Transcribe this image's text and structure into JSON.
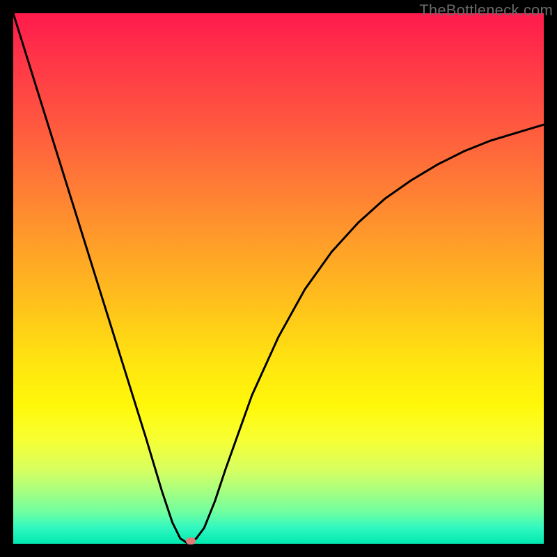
{
  "watermark": "TheBottleneck.com",
  "chart_data": {
    "type": "line",
    "title": "",
    "xlabel": "",
    "ylabel": "",
    "xlim": [
      0,
      100
    ],
    "ylim": [
      0,
      100
    ],
    "series": [
      {
        "name": "bottleneck-curve",
        "x": [
          0,
          5,
          10,
          15,
          20,
          25,
          28,
          30,
          31.5,
          33,
          34.5,
          36,
          38,
          40,
          45,
          50,
          55,
          60,
          65,
          70,
          75,
          80,
          85,
          90,
          95,
          100
        ],
        "y": [
          100,
          84,
          68,
          52,
          36,
          20,
          10,
          4,
          1,
          0,
          1,
          3,
          8,
          14,
          28,
          39,
          48,
          55,
          60.5,
          65,
          68.5,
          71.5,
          74,
          76,
          77.5,
          79
        ]
      }
    ],
    "marker": {
      "x": 33.5,
      "y": 0.5
    },
    "background_gradient": {
      "top": "#ff1a4d",
      "mid_upper": "#ffa028",
      "mid": "#fff80a",
      "bottom": "#00e8b0"
    }
  }
}
